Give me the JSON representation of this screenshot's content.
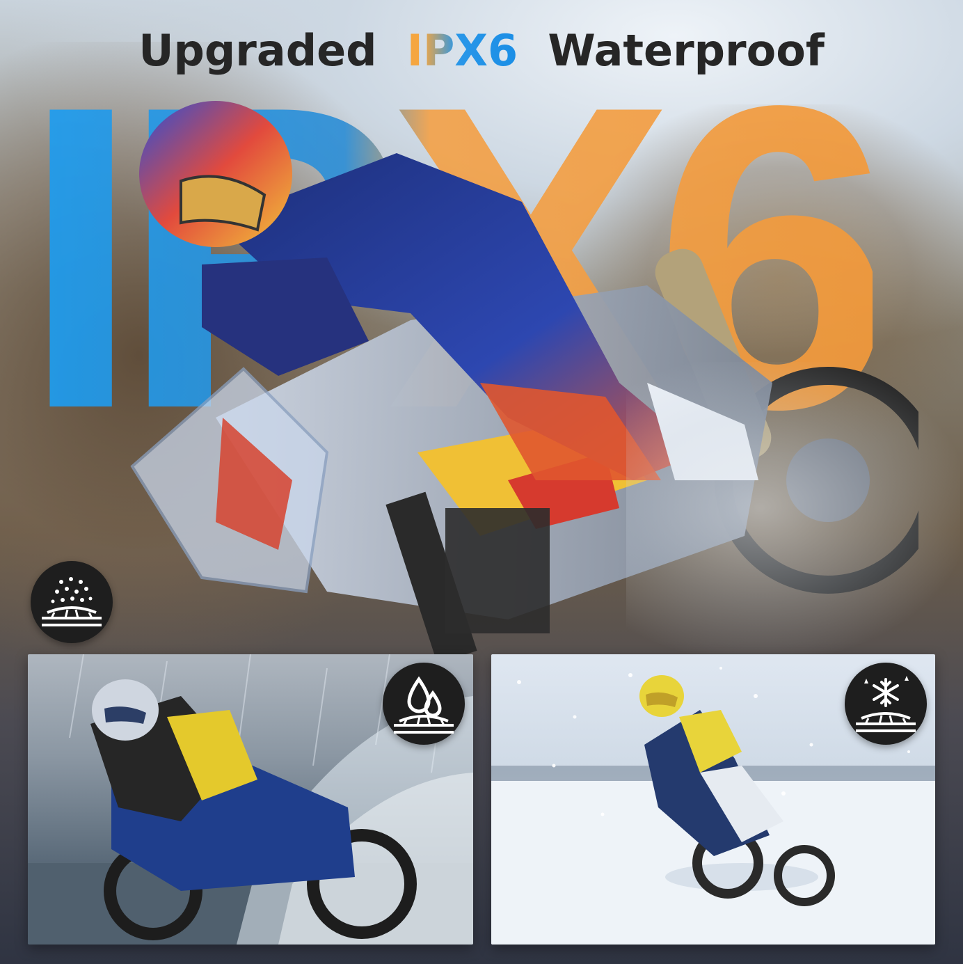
{
  "headline": {
    "word_before": "Upgraded",
    "rating_letter_i": "I",
    "rating_rest": "PX6",
    "word_after": "Waterproof"
  },
  "background_text": "IPX6",
  "icons": {
    "dustproof": "dustproof-icon",
    "water": "water-drops-icon",
    "snow": "snowflake-icon"
  },
  "colors": {
    "blue": "#1c9ef2",
    "orange": "#f5a640",
    "headline_dark": "#262626",
    "badge_dark": "#1e1e1e"
  }
}
